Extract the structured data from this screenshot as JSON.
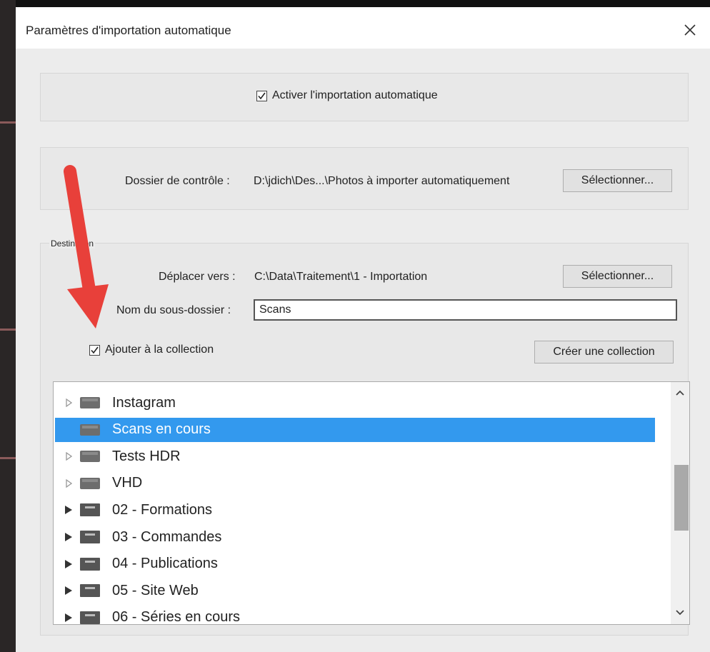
{
  "dialog": {
    "title": "Paramètres d'importation automatique"
  },
  "auto_import": {
    "enable_label": "Activer l'importation automatique",
    "enabled": true
  },
  "watch": {
    "label": "Dossier de contrôle :",
    "path": "D:\\jdich\\Des...\\Photos à importer automatiquement",
    "select_label": "Sélectionner..."
  },
  "destination": {
    "group_label": "Destination",
    "move_label": "Déplacer vers :",
    "move_path": "C:\\Data\\Traitement\\1 - Importation",
    "select_label": "Sélectionner...",
    "subfolder_label": "Nom du sous-dossier :",
    "subfolder_value": "Scans",
    "add_collection_label": "Ajouter à la collection",
    "add_collection_checked": true,
    "create_collection_label": "Créer une collection"
  },
  "collections": [
    {
      "name": "Instagram",
      "icon": "collection-icon",
      "expander": "light"
    },
    {
      "name": "Scans en cours",
      "icon": "collection-icon",
      "expander": "none",
      "selected": true
    },
    {
      "name": "Tests HDR",
      "icon": "collection-icon",
      "expander": "light"
    },
    {
      "name": "VHD",
      "icon": "collection-icon",
      "expander": "light"
    },
    {
      "name": "02 - Formations",
      "icon": "collection-set-icon",
      "expander": "dark"
    },
    {
      "name": "03 - Commandes",
      "icon": "collection-set-icon",
      "expander": "dark"
    },
    {
      "name": "04 - Publications",
      "icon": "collection-set-icon",
      "expander": "dark"
    },
    {
      "name": "05 - Site Web",
      "icon": "collection-set-icon",
      "expander": "dark"
    },
    {
      "name": "06 - Séries en cours",
      "icon": "collection-set-icon",
      "expander": "dark"
    }
  ],
  "colors": {
    "selection": "#3399ee",
    "annotation_arrow": "#e8403a"
  }
}
